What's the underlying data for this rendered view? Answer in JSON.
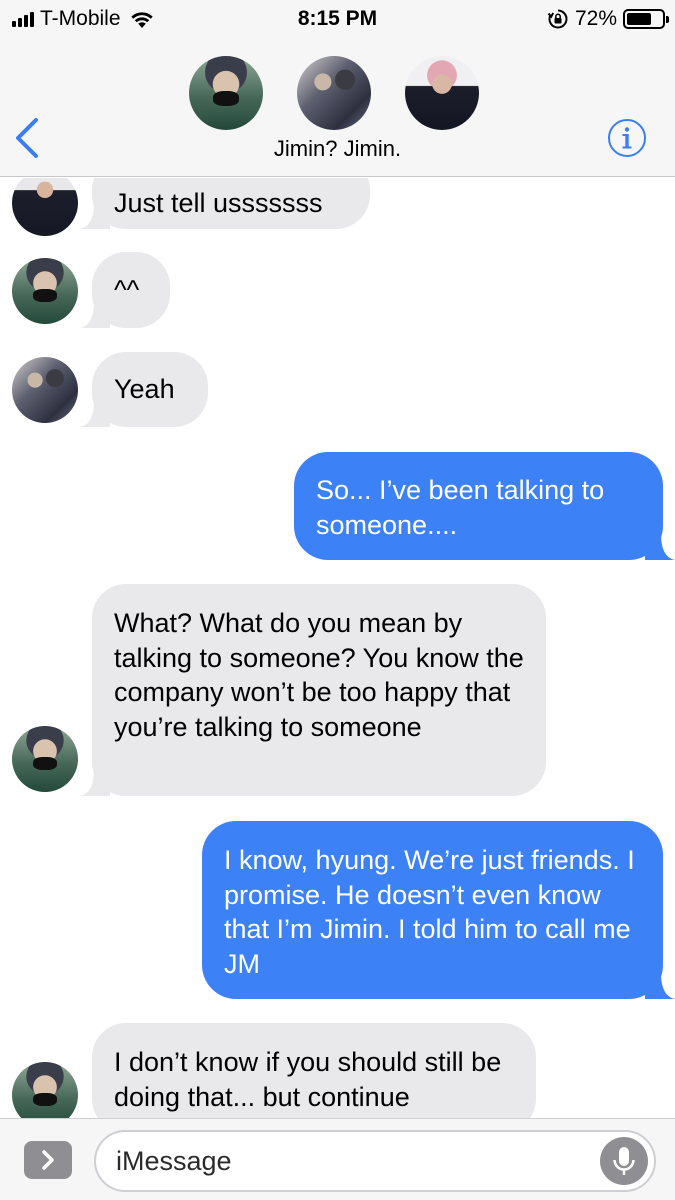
{
  "status_bar": {
    "carrier": "T-Mobile",
    "time": "8:15 PM",
    "battery_percent": "72%",
    "battery_level": 0.72,
    "signal_bars": 4,
    "icons": [
      "signal-icon",
      "wifi-icon",
      "rotation-lock-icon",
      "battery-icon"
    ]
  },
  "header": {
    "back_icon": "chevron-left-icon",
    "group_name": "Jimin? Jimin.",
    "info_icon": "info-icon",
    "participant_avatars": [
      "avatar-masked",
      "avatar-duo",
      "avatar-pink-hair"
    ]
  },
  "messages": [
    {
      "direction": "incoming",
      "sender_avatar": "avatar-pink-hair",
      "text": "Just tell usssssss"
    },
    {
      "direction": "incoming",
      "sender_avatar": "avatar-masked",
      "text": "^^"
    },
    {
      "direction": "incoming",
      "sender_avatar": "avatar-duo",
      "text": "Yeah"
    },
    {
      "direction": "outgoing",
      "text": "So... I’ve been talking to someone...."
    },
    {
      "direction": "incoming",
      "sender_avatar": "avatar-masked",
      "text": "What? What do you mean by talking to someone? You know the company won’t be too happy that you’re talking to someone"
    },
    {
      "direction": "outgoing",
      "text": "I know, hyung. We’re just friends. I promise. He doesn’t even know that I’m Jimin. I told him to call me JM"
    },
    {
      "direction": "incoming",
      "sender_avatar": "avatar-masked",
      "text": "I don’t know if you should still be doing that... but continue"
    }
  ],
  "input_bar": {
    "apps_icon": "chevron-right-icon",
    "placeholder": "iMessage",
    "mic_icon": "microphone-icon"
  },
  "colors": {
    "outgoing_bubble": "#3c82f6",
    "incoming_bubble": "#e9e9eb",
    "accent": "#3b7ef2",
    "chrome_background": "#f6f6f7"
  }
}
